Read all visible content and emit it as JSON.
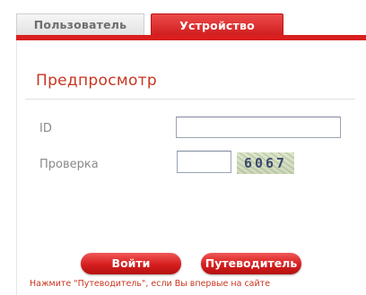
{
  "tabs": {
    "user_label": "Пользователь",
    "device_label": "Устройство"
  },
  "panel": {
    "title": "Предпросмотр"
  },
  "form": {
    "id_label": "ID",
    "id_value": "",
    "check_label": "Проверка",
    "check_value": "",
    "captcha_text": "6067"
  },
  "buttons": {
    "login_label": "Войти",
    "guide_label": "Путеводитель"
  },
  "hint": "Нажмите \"Путеводитель\", если Вы впервые на сайте",
  "colors": {
    "accent_red": "#d91f1f",
    "title_red": "#c8351f"
  }
}
